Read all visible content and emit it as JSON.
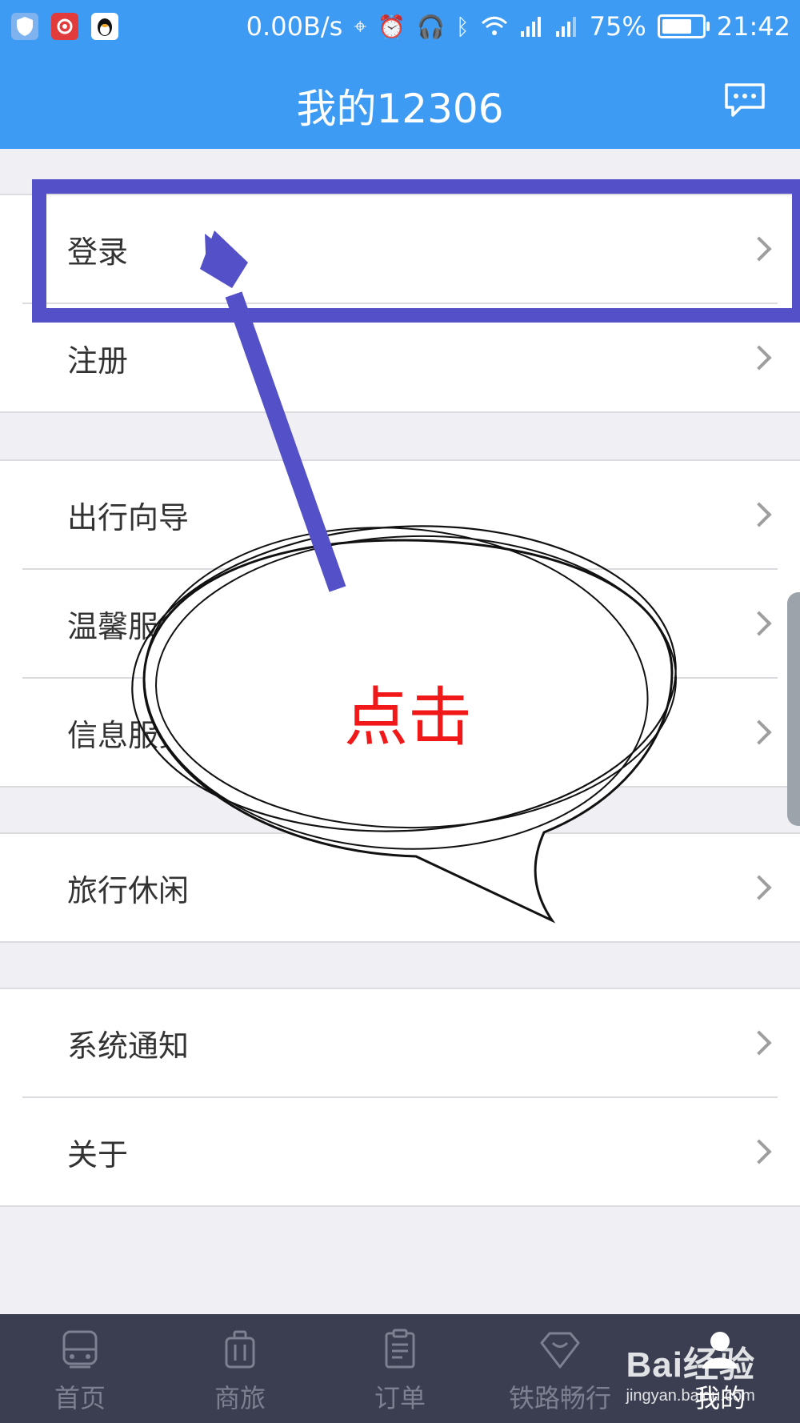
{
  "status_bar": {
    "net_speed": "0.00B/s",
    "battery": "75%",
    "battery_level": 0.75,
    "time": "21:42",
    "apps": [
      "shield-app-icon",
      "netease-music-icon",
      "qq-penguin-icon"
    ]
  },
  "header": {
    "title": "我的12306"
  },
  "menu": {
    "login": "登录",
    "register": "注册",
    "travel_guide": "出行向导",
    "warm_service": "温馨服务",
    "info_service": "信息服务",
    "travel_leisure": "旅行休闲",
    "system_notice": "系统通知",
    "about": "关于"
  },
  "annotation": {
    "callout_text": "点击"
  },
  "bottom_nav": {
    "tabs": [
      {
        "label": "首页",
        "icon": "train-icon"
      },
      {
        "label": "商旅",
        "icon": "luggage-icon"
      },
      {
        "label": "订单",
        "icon": "clipboard-icon"
      },
      {
        "label": "铁路畅行",
        "icon": "diamond-icon"
      },
      {
        "label": "我的",
        "icon": "user-icon",
        "active": true
      }
    ]
  },
  "watermark": {
    "main": "Bai经验",
    "sub": "jingyan.baidu.com"
  },
  "colors": {
    "header_blue": "#3d9bf4",
    "highlight_purple": "#5450c8",
    "callout_red": "#f01818",
    "nav_dark": "#3b3e50"
  }
}
